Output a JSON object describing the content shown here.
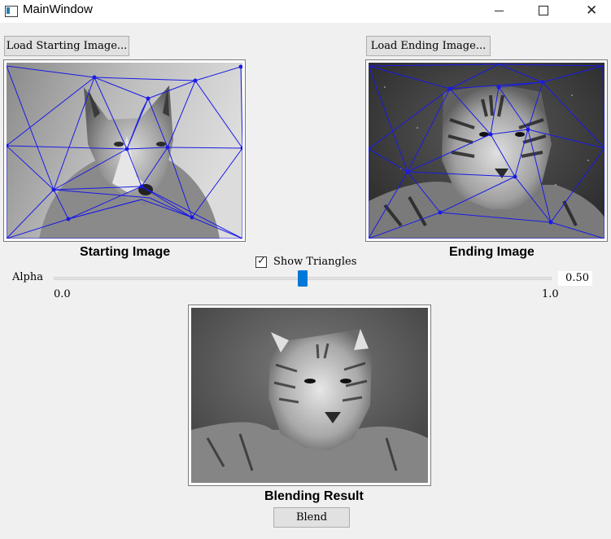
{
  "window": {
    "title": "MainWindow"
  },
  "buttons": {
    "load_start": "Load Starting Image...",
    "load_end": "Load Ending Image...",
    "blend": "Blend"
  },
  "labels": {
    "starting": "Starting Image",
    "ending": "Ending Image",
    "blending": "Blending Result"
  },
  "show_triangles": {
    "label": "Show Triangles",
    "checked": true
  },
  "alpha": {
    "label": "Alpha",
    "value": "0.50",
    "min_label": "0.0",
    "max_label": "1.0",
    "fraction": 0.5
  },
  "colors": {
    "triangle_line": "#1a1ae6",
    "slider_handle": "#0078d7"
  },
  "images": {
    "starting": "wolf photo (grayscale)",
    "ending": "tiger photo (grayscale)",
    "result": "blended tiger-wolf photo (grayscale)"
  }
}
